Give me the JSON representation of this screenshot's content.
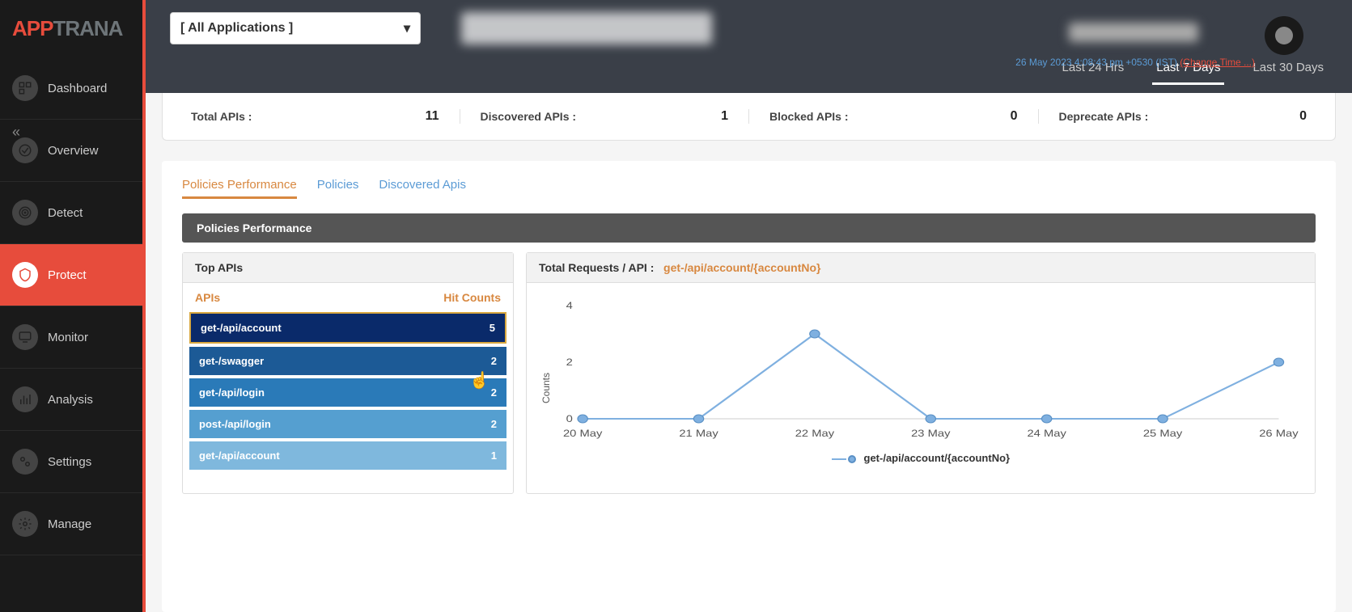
{
  "brand": {
    "app": "APP",
    "suffix": "TRANA"
  },
  "sidebar": {
    "items": [
      {
        "label": "Dashboard"
      },
      {
        "label": "Overview"
      },
      {
        "label": "Detect"
      },
      {
        "label": "Protect"
      },
      {
        "label": "Monitor"
      },
      {
        "label": "Analysis"
      },
      {
        "label": "Settings"
      },
      {
        "label": "Manage"
      }
    ]
  },
  "header": {
    "app_dropdown": "[ All Applications ]",
    "timestamp": "26 May 2023 4:08:43 pm +0530 (IST)",
    "change_time": "(Change Time ...)"
  },
  "time_tabs": {
    "t24": "Last 24 Hrs",
    "t7": "Last 7 Days",
    "t30": "Last 30 Days"
  },
  "stats": {
    "total_label": "Total APIs :",
    "total_value": "11",
    "discovered_label": "Discovered APIs :",
    "discovered_value": "1",
    "blocked_label": "Blocked APIs :",
    "blocked_value": "0",
    "deprecate_label": "Deprecate APIs :",
    "deprecate_value": "0"
  },
  "sub_tabs": {
    "t1": "Policies Performance",
    "t2": "Policies",
    "t3": "Discovered Apis"
  },
  "section_header": "Policies Performance",
  "top_apis": {
    "title": "Top APIs",
    "col_api": "APIs",
    "col_hits": "Hit Counts",
    "rows": [
      {
        "name": "get-/api/account",
        "count": "5"
      },
      {
        "name": "get-/swagger",
        "count": "2"
      },
      {
        "name": "get-/api/login",
        "count": "2"
      },
      {
        "name": "post-/api/login",
        "count": "2"
      },
      {
        "name": "get-/api/account",
        "count": "1"
      }
    ]
  },
  "chart": {
    "title_prefix": "Total Requests / API :",
    "api_name": "get-/api/account/{accountNo}",
    "ylabel": "Counts",
    "legend": "get-/api/account/{accountNo}"
  },
  "chart_data": {
    "type": "line",
    "title": "Total Requests / API : get-/api/account/{accountNo}",
    "xlabel": "",
    "ylabel": "Counts",
    "ylim": [
      0,
      4
    ],
    "categories": [
      "20 May",
      "21 May",
      "22 May",
      "23 May",
      "24 May",
      "25 May",
      "26 May"
    ],
    "series": [
      {
        "name": "get-/api/account/{accountNo}",
        "values": [
          0,
          0,
          3,
          0,
          0,
          0,
          2
        ]
      }
    ],
    "yticks": [
      0,
      2,
      4
    ]
  }
}
